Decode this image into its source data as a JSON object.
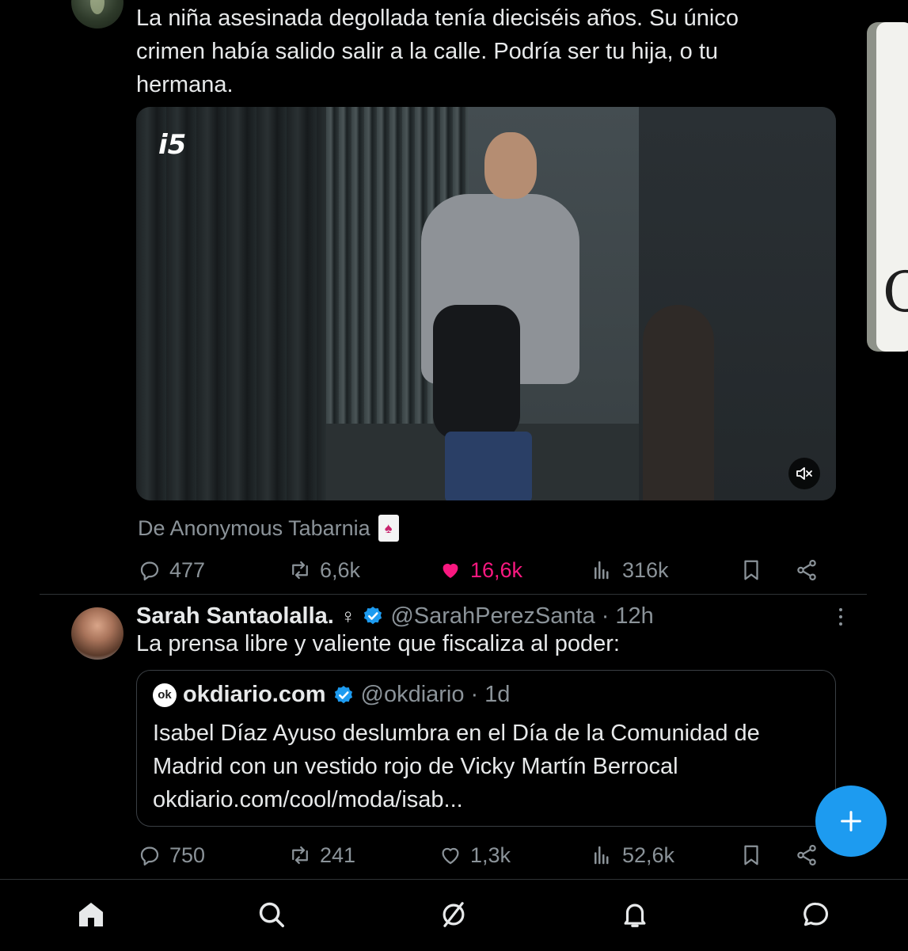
{
  "tweet1": {
    "text": "La niña asesinada degollada tenía dieciséis años. Su único\ncrimen había salido salir a la calle. Podría ser tu hija, o tu\nhermana.",
    "media": {
      "logo": "i5",
      "mute_icon": "mute-icon"
    },
    "source": "De Anonymous Tabarnia",
    "actions": {
      "replies": "477",
      "retweets": "6,6k",
      "likes": "16,6k",
      "views": "316k"
    },
    "liked": true,
    "like_color": "#f91880"
  },
  "side_card": {
    "letter": "C"
  },
  "tweet2": {
    "name": "Sarah Santaolalla.",
    "symbol": "♀",
    "handle": "@SarahPerezSanta",
    "dot": "·",
    "time": "12h",
    "text": "La prensa libre y valiente que fiscaliza al poder:",
    "quote": {
      "logo": "ok",
      "name": "okdiario.com",
      "handle": "@okdiario",
      "dot": "·",
      "time": "1d",
      "text": "Isabel Díaz Ayuso deslumbra en el Día de la Comunidad de Madrid con un vestido rojo de Vicky Martín Berrocal okdiario.com/cool/moda/isab..."
    },
    "actions": {
      "replies": "750",
      "retweets": "241",
      "likes": "1,3k",
      "views": "52,6k"
    }
  },
  "colors": {
    "accent": "#1d9bf0",
    "muted": "#8b9399",
    "background": "#000000"
  },
  "nav": [
    "home-icon",
    "search-icon",
    "communities-icon",
    "notifications-icon",
    "messages-icon"
  ]
}
